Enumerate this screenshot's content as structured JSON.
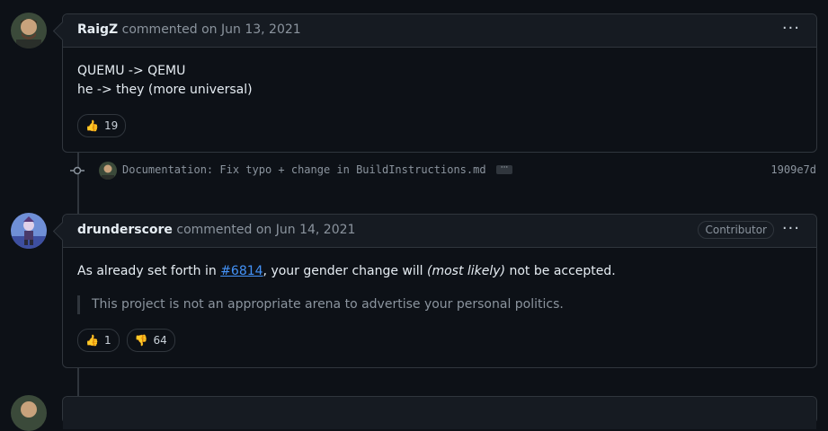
{
  "comments": [
    {
      "author": "RaigZ",
      "meta": "commented on Jun 13, 2021",
      "body_lines": [
        "QUEMU -> QEMU",
        "he -> they (more universal)"
      ],
      "reactions": [
        {
          "emoji": "thumbs-up",
          "glyph": "👍",
          "count": "19"
        }
      ],
      "more": "···"
    },
    {
      "author": "drunderscore",
      "meta": "commented on Jun 14, 2021",
      "badge": "Contributor",
      "body": {
        "before": "As already set forth in ",
        "link": "#6814",
        "middle": ", your gender change will ",
        "emphasis": "(most likely)",
        "after": " not be accepted."
      },
      "quote": "This project is not an appropriate arena to advertise your personal politics.",
      "reactions": [
        {
          "emoji": "thumbs-up",
          "glyph": "👍",
          "count": "1"
        },
        {
          "emoji": "thumbs-down",
          "glyph": "👎",
          "count": "64"
        }
      ],
      "more": "···"
    }
  ],
  "commit": {
    "message": "Documentation: Fix typo + change in BuildInstructions.md",
    "ellipsis": "···",
    "sha": "1909e7d"
  },
  "colors": {
    "background": "#0d1117",
    "border": "#30363d",
    "link": "#4493f8"
  }
}
